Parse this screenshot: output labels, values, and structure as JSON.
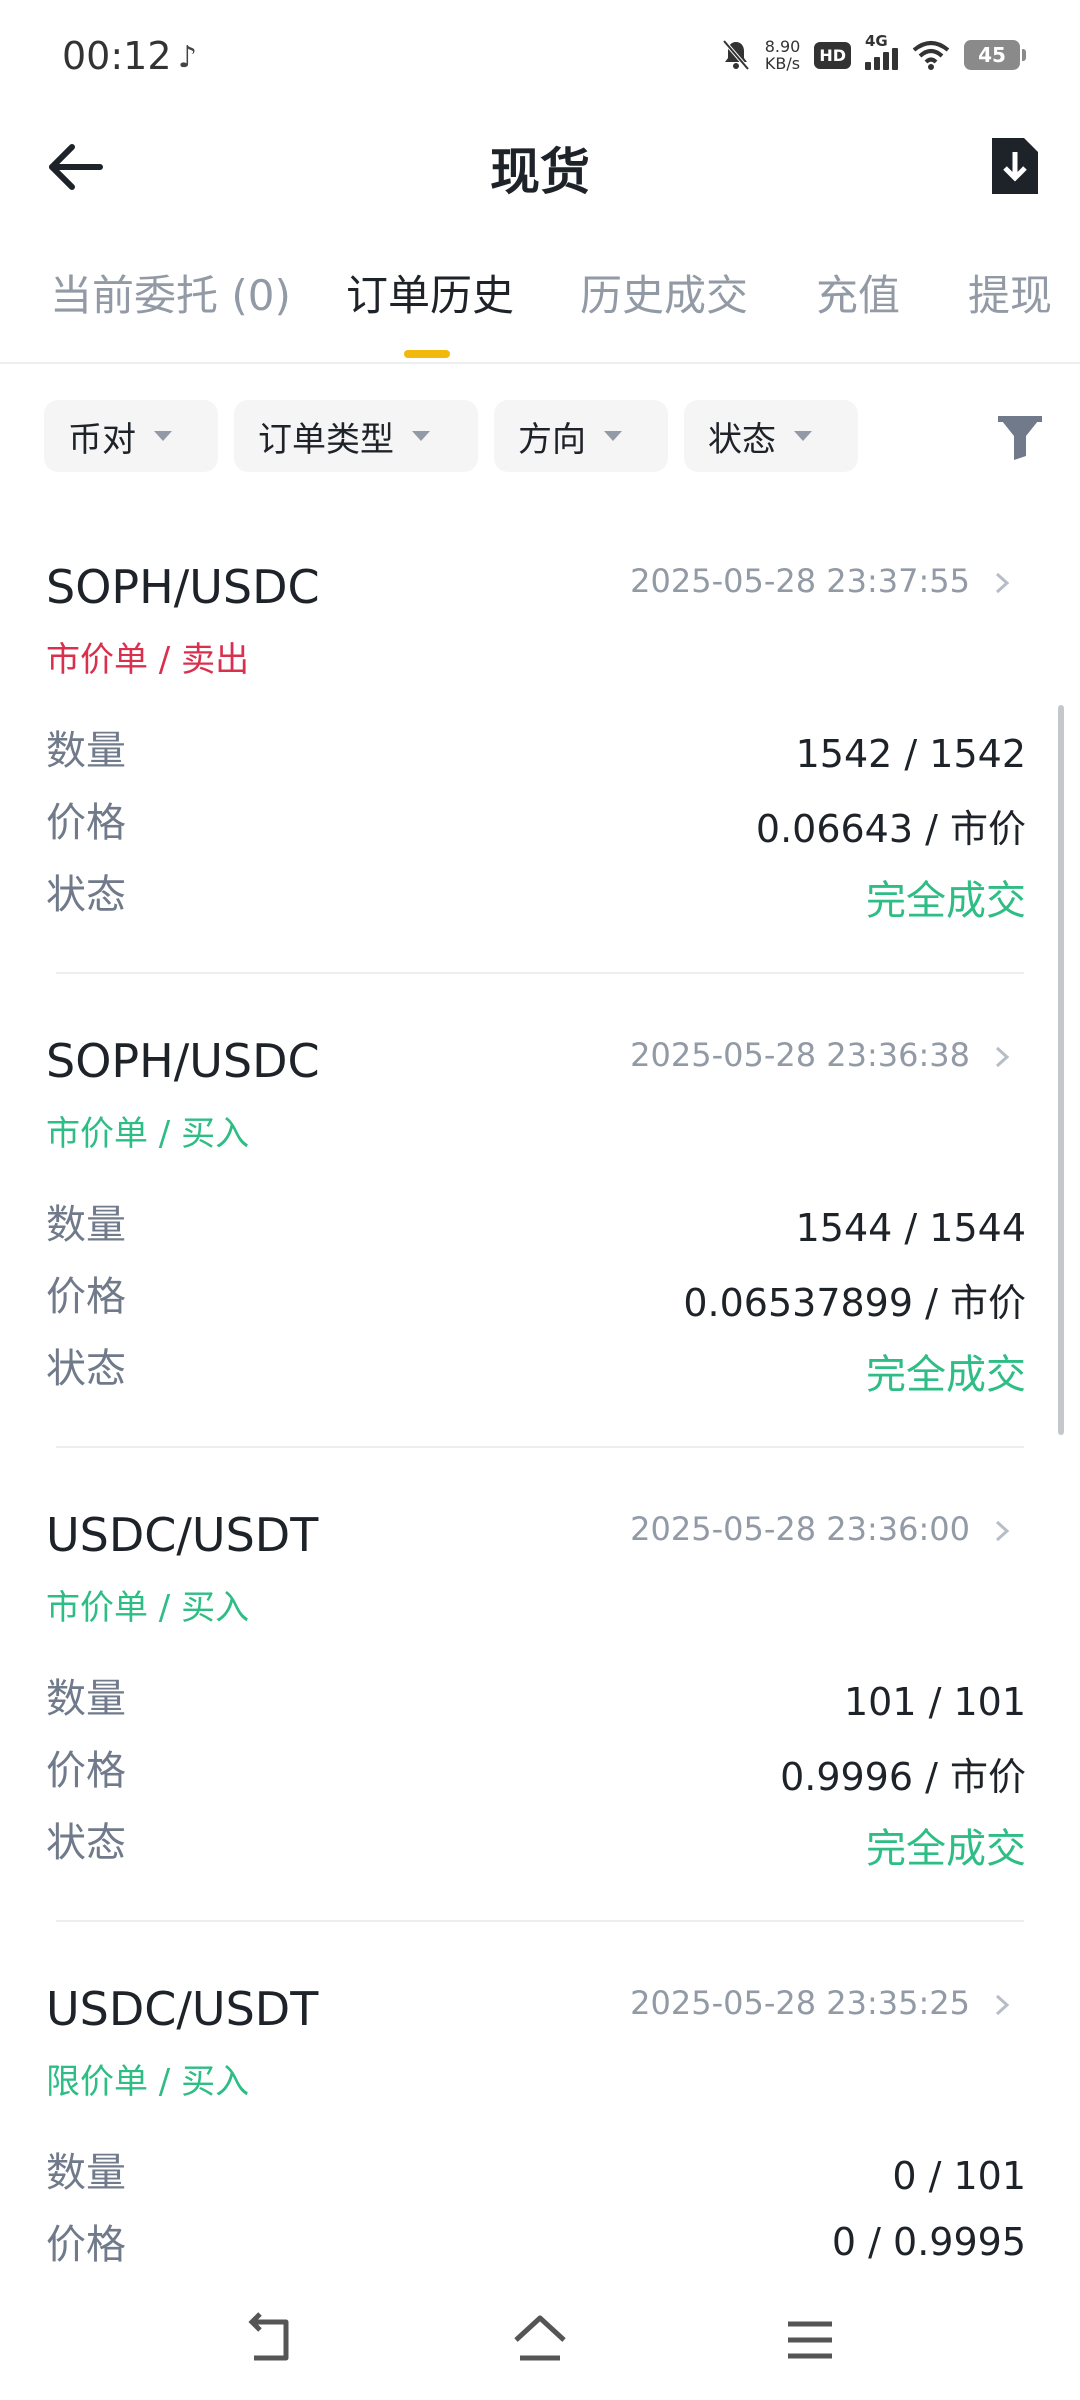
{
  "status_bar": {
    "time": "00:12",
    "net_speed_value": "8.90",
    "net_speed_unit": "KB/s",
    "hd": "HD",
    "network": "4G",
    "battery": "45"
  },
  "header": {
    "title": "现货",
    "back_icon": "arrow-left-icon",
    "download_icon": "file-download-icon"
  },
  "tabs": [
    {
      "label": "当前委托 (0)"
    },
    {
      "label": "订单历史",
      "active": true
    },
    {
      "label": "历史成交"
    },
    {
      "label": "充值"
    },
    {
      "label": "提现"
    }
  ],
  "filters": [
    {
      "label": "币对"
    },
    {
      "label": "订单类型"
    },
    {
      "label": "方向"
    },
    {
      "label": "状态"
    }
  ],
  "labels": {
    "quantity": "数量",
    "price": "价格",
    "status": "状态"
  },
  "orders": [
    {
      "pair": "SOPH/USDC",
      "type": "市价单 / 卖出",
      "side": "sell",
      "time": "2025-05-28 23:37:55",
      "quantity": "1542 / 1542",
      "price": "0.06643 / 市价",
      "status": "完全成交"
    },
    {
      "pair": "SOPH/USDC",
      "type": "市价单 / 买入",
      "side": "buy",
      "time": "2025-05-28 23:36:38",
      "quantity": "1544 / 1544",
      "price": "0.06537899 / 市价",
      "status": "完全成交"
    },
    {
      "pair": "USDC/USDT",
      "type": "市价单 / 买入",
      "side": "buy",
      "time": "2025-05-28 23:36:00",
      "quantity": "101 / 101",
      "price": "0.9996 / 市价",
      "status": "完全成交"
    },
    {
      "pair": "USDC/USDT",
      "type": "限价单 / 买入",
      "side": "buy",
      "time": "2025-05-28 23:35:25",
      "quantity": "0 / 101",
      "price": "0 / 0.9995",
      "status": ""
    }
  ],
  "colors": {
    "accent": "#f0b90b",
    "buy": "#2ebd85",
    "sell": "#d9304e",
    "muted": "#929aa5"
  }
}
